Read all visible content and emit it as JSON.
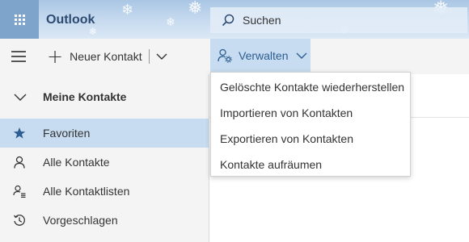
{
  "header": {
    "app_title": "Outlook",
    "search_placeholder": "Suchen"
  },
  "commandbar": {
    "new_contact_label": "Neuer Kontakt",
    "manage_label": "Verwalten"
  },
  "sidebar": {
    "group_label": "Meine Kontakte",
    "items": [
      {
        "label": "Favoriten",
        "icon": "star-icon",
        "selected": true
      },
      {
        "label": "Alle Kontakte",
        "icon": "person-icon",
        "selected": false
      },
      {
        "label": "Alle Kontaktlisten",
        "icon": "contact-lists-icon",
        "selected": false
      },
      {
        "label": "Vorgeschlagen",
        "icon": "history-icon",
        "selected": false
      }
    ]
  },
  "manage_menu": {
    "items": [
      {
        "label": "Gelöschte Kontakte wiederherstellen"
      },
      {
        "label": "Importieren von Kontakten"
      },
      {
        "label": "Exportieren von Kontakten"
      },
      {
        "label": "Kontakte aufräumen"
      }
    ]
  },
  "colors": {
    "accent": "#2d5e91",
    "selected_bg": "#c7dcf0",
    "waffle_bg": "#7fa4cb"
  }
}
